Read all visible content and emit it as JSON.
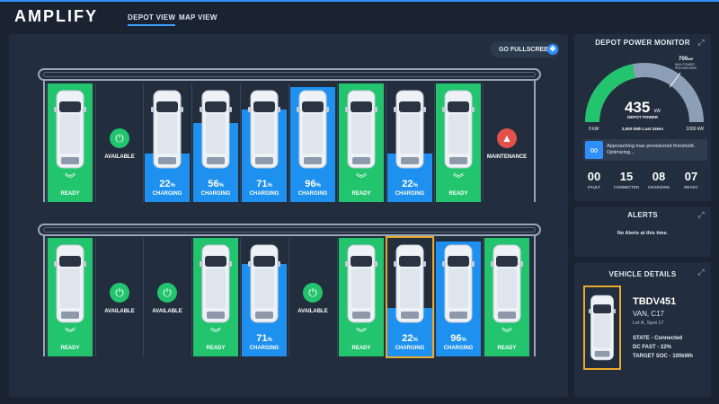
{
  "app": {
    "logo": "AMPLIFY"
  },
  "nav": {
    "tabs": [
      {
        "label": "DEPOT VIEW",
        "active": true
      },
      {
        "label": "MAP VIEW",
        "active": false
      }
    ]
  },
  "depot": {
    "fullscreen_label": "GO FULLSCREEN",
    "row1": [
      {
        "kind": "car",
        "state": "ready",
        "label": "READY"
      },
      {
        "kind": "available",
        "label": "AVAILABLE"
      },
      {
        "kind": "car",
        "state": "charging",
        "percent": 22,
        "pct_unit": "%",
        "label": "CHARGING"
      },
      {
        "kind": "car",
        "state": "charging",
        "percent": 56,
        "pct_unit": "%",
        "label": "CHARGING"
      },
      {
        "kind": "car",
        "state": "charging",
        "percent": 71,
        "pct_unit": "%",
        "label": "CHARGING"
      },
      {
        "kind": "car",
        "state": "charging",
        "percent": 96,
        "pct_unit": "%",
        "label": "CHARGING"
      },
      {
        "kind": "car",
        "state": "ready",
        "label": "READY"
      },
      {
        "kind": "car",
        "state": "charging",
        "percent": 22,
        "pct_unit": "%",
        "label": "CHARGING"
      },
      {
        "kind": "car",
        "state": "ready",
        "label": "READY"
      },
      {
        "kind": "maintenance",
        "label": "MAINTENANCE"
      }
    ],
    "row2": [
      {
        "kind": "car",
        "state": "ready",
        "label": "READY"
      },
      {
        "kind": "available",
        "label": "AVAILABLE"
      },
      {
        "kind": "available",
        "label": "AVAILABLE"
      },
      {
        "kind": "car",
        "state": "ready",
        "label": "READY"
      },
      {
        "kind": "car",
        "state": "charging",
        "percent": 71,
        "pct_unit": "%",
        "label": "CHARGING"
      },
      {
        "kind": "available",
        "label": "AVAILABLE"
      },
      {
        "kind": "car",
        "state": "ready",
        "label": "READY"
      },
      {
        "kind": "car",
        "state": "charging",
        "percent": 22,
        "pct_unit": "%",
        "label": "CHARGING",
        "selected": true
      },
      {
        "kind": "car",
        "state": "charging",
        "percent": 96,
        "pct_unit": "%",
        "label": "CHARGING"
      },
      {
        "kind": "car",
        "state": "ready",
        "label": "READY"
      }
    ]
  },
  "power": {
    "title": "DEPOT POWER MONITOR",
    "value": "435",
    "unit": "kW",
    "value_label": "DEPOT POWER",
    "max_value": "700",
    "max_unit": "kW",
    "max_label": "MAX POWER PROVISIONED",
    "min_scale": "0 kW",
    "max_scale": "1000 kW",
    "daily": "2,000 kWh Last 24Hrs",
    "warning": "Approaching max provisioned threshold. Optimizing...",
    "current_fraction": 0.435,
    "provisioned_fraction": 0.7,
    "stats": [
      {
        "num": "00",
        "name": "FAULT"
      },
      {
        "num": "15",
        "name": "CONNECTED"
      },
      {
        "num": "08",
        "name": "CHARGING"
      },
      {
        "num": "07",
        "name": "READY"
      }
    ]
  },
  "alerts": {
    "title": "ALERTS",
    "message": "No Alerts at this time."
  },
  "vehicle": {
    "title": "VEHICLE DETAILS",
    "id": "TBDV451",
    "type": "VAN, C17",
    "lot": "Lot A, Spot 17",
    "state": "STATE - Connected",
    "charge": "DC FAST - 22%",
    "target": "TARGET SOC - 100kWh"
  },
  "colors": {
    "ready": "#22c46e",
    "charging": "#1e90f0",
    "accent": "#2f8fff",
    "selected": "#e9a92c",
    "maintenance": "#e2524a"
  },
  "icons": {
    "available": "plug-icon",
    "maintenance": "cone-icon",
    "ready": "chevrons-down-icon",
    "fullscreen": "expand-icon",
    "warning": "infinity-icon"
  }
}
